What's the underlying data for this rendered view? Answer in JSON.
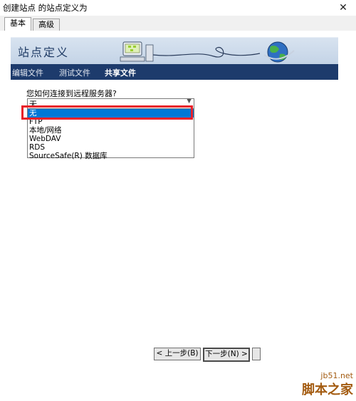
{
  "window": {
    "title": "创建站点 的站点定义为",
    "close_glyph": "✕"
  },
  "tabs": [
    {
      "label": "基本",
      "active": true
    },
    {
      "label": "高级",
      "active": false
    }
  ],
  "banner": {
    "title": "站点定义"
  },
  "nav": {
    "items": [
      {
        "label": "编辑文件",
        "active": false
      },
      {
        "label": "测试文件",
        "active": false
      },
      {
        "label": "共享文件",
        "active": true
      }
    ]
  },
  "form": {
    "question": "您如何连接到远程服务器?",
    "select_value": "无",
    "options": [
      "无",
      "FTP",
      "本地/网络",
      "WebDAV",
      "RDS",
      "SourceSafe(R) 数据库"
    ],
    "selected_option": "无"
  },
  "buttons": {
    "back": "< 上一步(B)",
    "next": "下一步(N) >"
  },
  "watermark": {
    "site": "jb51.net",
    "brand": "脚本之家"
  },
  "colors": {
    "nav_bg": "#1d3b6c",
    "banner_bg": "#c3d3e6",
    "selection": "#0078d7",
    "highlight_box": "#e8212a",
    "watermark": "#a35b10"
  },
  "icons": [
    "close-icon",
    "network-computer-icon",
    "globe-icon",
    "dropdown-arrow-icon"
  ]
}
